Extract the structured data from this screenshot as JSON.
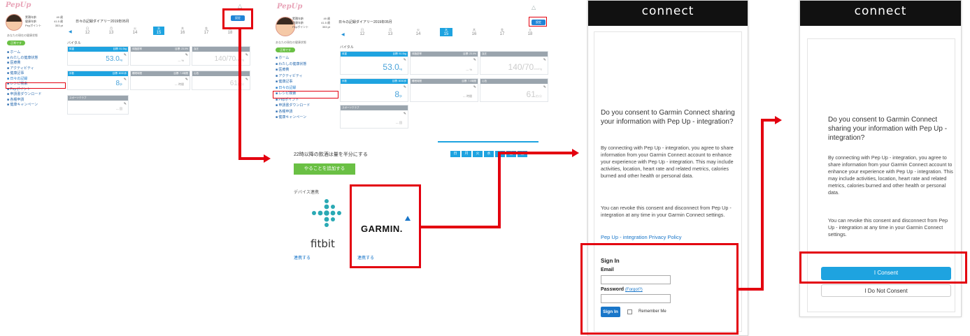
{
  "colors": {
    "annotation": "#e3000f",
    "accent": "#1ea3e0",
    "green": "#6ac044",
    "dark_bar": "#111111"
  },
  "app": {
    "logo": "PepUp",
    "profile": {
      "stats": [
        {
          "label": "累積年齢",
          "value": "49 歳"
        },
        {
          "label": "健康年齢",
          "value": "41.5 歳"
        },
        {
          "label": "Pepポイント",
          "value": "353 pt"
        }
      ]
    },
    "diary_title": "日々の記録ダイアリー2019年05月",
    "settings_label": "設定",
    "dates": [
      {
        "w": "日",
        "d": "12"
      },
      {
        "w": "月",
        "d": "13"
      },
      {
        "w": "火",
        "d": "14"
      },
      {
        "w": "水",
        "d": "15"
      },
      {
        "w": "木",
        "d": "16"
      },
      {
        "w": "金",
        "d": "17"
      },
      {
        "w": "土",
        "d": "18"
      }
    ],
    "side_note": "あなたの現在の健康状態",
    "status_pill": "正常です",
    "menu": [
      "ホーム",
      "わたしの健康状態",
      "医療費",
      "アクティビティ",
      "健康記事",
      "日々の記録",
      "レシピ検索",
      "Pepポイント",
      "申請書ダウンロード",
      "各種申請",
      "健康キャンペーン"
    ],
    "vitals_label": "バイタル",
    "cards": [
      {
        "title": "体重",
        "goal": "目標: 51.0kg",
        "value": "53.0",
        "unit": "kg",
        "style": "blue"
      },
      {
        "title": "体脂肪率",
        "goal": "目標: 23.0%",
        "value": "---",
        "unit": "%",
        "style": "gray"
      },
      {
        "title": "血圧",
        "goal": "",
        "value": "140/70",
        "unit": "mmHg",
        "style": "gray"
      },
      {
        "title": "歩数",
        "goal": "目標: 8000歩",
        "value": "8",
        "unit": "歩",
        "style": "blue"
      },
      {
        "title": "睡眠時間",
        "goal": "目標: 7.0時間",
        "value": "---",
        "unit": "時間",
        "style": "gray"
      },
      {
        "title": "心拍",
        "goal": "",
        "value": "61",
        "unit": "拍/分",
        "style": "gray"
      },
      {
        "title": "スポーツクラブ",
        "goal": "",
        "value": "---",
        "unit": "回",
        "style": "gray"
      }
    ]
  },
  "device": {
    "goal_text": "22時以降の飲酒は量を半分にする",
    "weekdays": [
      "日",
      "月",
      "火",
      "水",
      "木",
      "金",
      "土"
    ],
    "add_button": "やることを追加する",
    "section_label": "デバイス連携",
    "fitbit": "fitbit",
    "garmin": "GARMIN.",
    "link_fitbit": "連携する",
    "link_garmin": "連携する"
  },
  "connect": {
    "brand": "connect",
    "question": "Do you consent to Garmin Connect sharing your information with Pep Up - integration?",
    "para1": "By connecting with Pep Up - integration, you agree to share information from your Garmin Connect account to enhance your experience with Pep Up - integration. This may include activities, location, heart rate and related metrics, calories burned and other health or personal data.",
    "para2": "You can revoke this consent and disconnect from Pep Up - integration at any time in your Garmin Connect settings.",
    "privacy": "Pep Up - integration Privacy Policy",
    "signin_title": "Sign In",
    "email_label": "Email",
    "password_label": "Password",
    "forgot": "(Forgot?)",
    "signin_button": "Sign In",
    "remember": "Remember Me",
    "consent_button": "I Consent",
    "no_consent_button": "I Do Not Consent"
  }
}
